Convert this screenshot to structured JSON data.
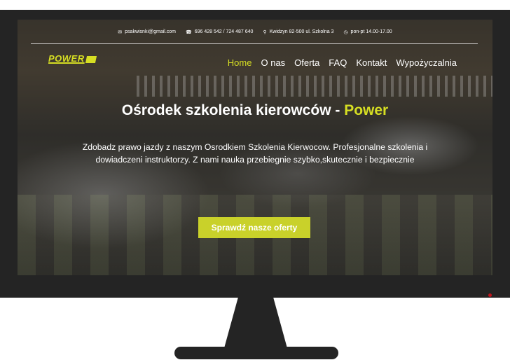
{
  "topbar": {
    "email": "psakwisnki@gmail.com",
    "phone": "696 428 542 / 724 487 640",
    "address": "Kwidzyn 82-500 ul. Szkolna 3",
    "hours": "pon-pt 14.00-17.00",
    "icons": [
      "envelope-icon",
      "phone-icon",
      "map-pin-icon",
      "clock-icon"
    ]
  },
  "logo": {
    "text": "POWER"
  },
  "nav": {
    "items": [
      {
        "label": "Home",
        "active": true
      },
      {
        "label": "O nas"
      },
      {
        "label": "Oferta"
      },
      {
        "label": "FAQ"
      },
      {
        "label": "Kontakt"
      },
      {
        "label": "Wypożyczalnia"
      }
    ]
  },
  "hero": {
    "title_main": "Ośrodek szkolenia kierowców - ",
    "title_highlight": "Power",
    "text": "Zdobadz prawo jazdy z naszym Osrodkiem Szkolenia Kierwocow. Profesjonalne szkolenia i dowiadczeni instruktorzy. Z nami nauka przebiegnie szybko,skutecznie i bezpiecznie",
    "cta_label": "Sprawdź nasze oferty"
  },
  "colors": {
    "accent": "#d6de23",
    "button": "#c9d12a",
    "monitor": "#242424"
  }
}
